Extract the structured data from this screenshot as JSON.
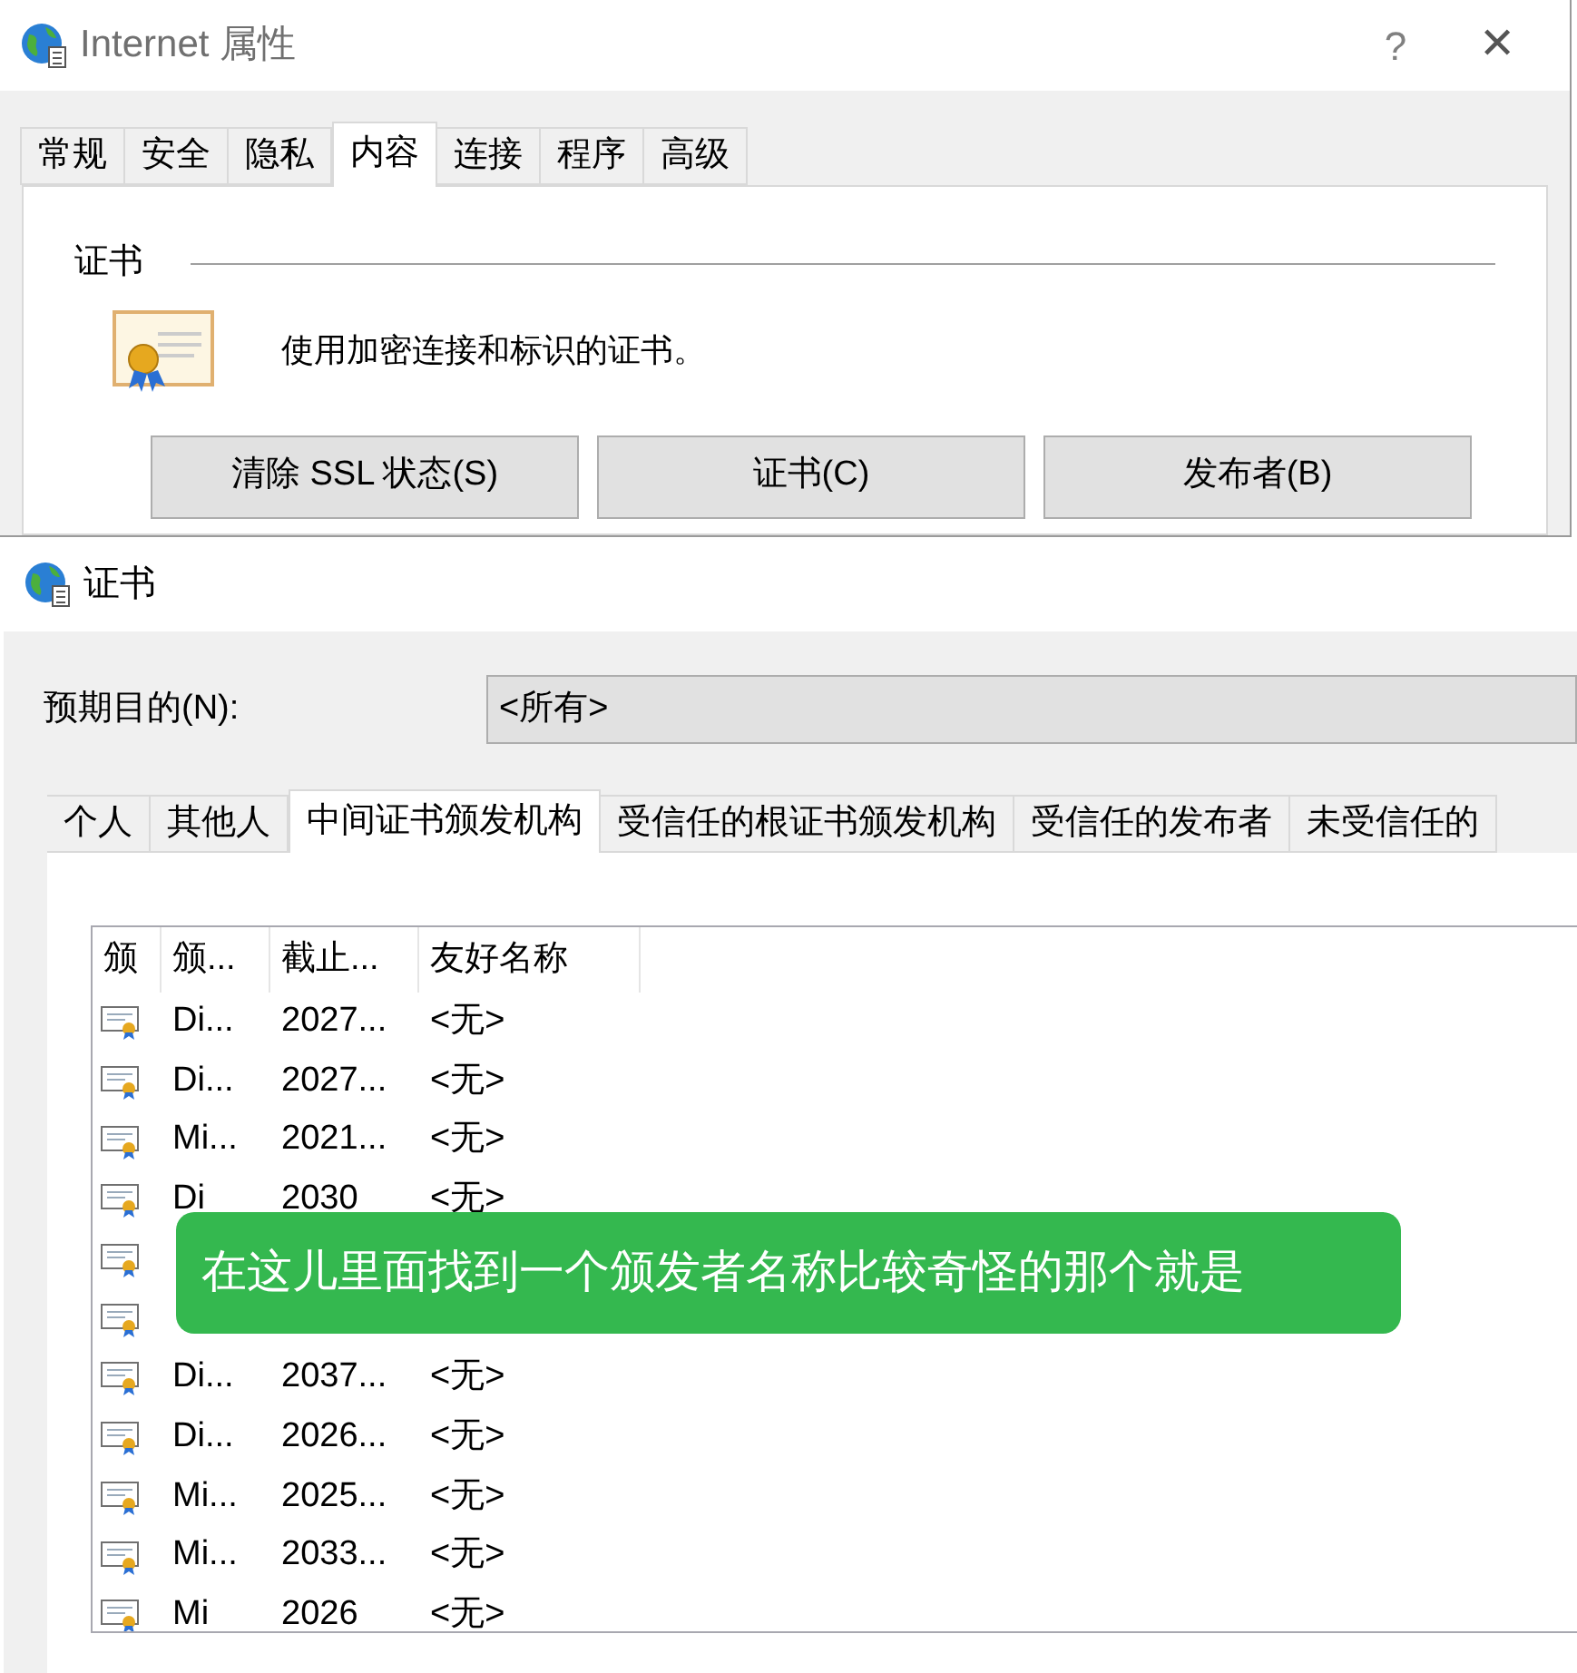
{
  "internet_options": {
    "title": "Internet 属性",
    "help": "?",
    "close": "✕",
    "tabs": [
      {
        "label": "常规",
        "selected": false
      },
      {
        "label": "安全",
        "selected": false
      },
      {
        "label": "隐私",
        "selected": false
      },
      {
        "label": "内容",
        "selected": true
      },
      {
        "label": "连接",
        "selected": false
      },
      {
        "label": "程序",
        "selected": false
      },
      {
        "label": "高级",
        "selected": false
      }
    ],
    "section": "证书",
    "description": "使用加密连接和标识的证书。",
    "buttons": [
      "清除 SSL 状态(S)",
      "证书(C)",
      "发布者(B)"
    ]
  },
  "certificates": {
    "title": "证书",
    "purpose_label": "预期目的(N):",
    "purpose_value": "<所有>",
    "tabs": [
      {
        "label": "个人",
        "selected": false
      },
      {
        "label": "其他人",
        "selected": false
      },
      {
        "label": "中间证书颁发机构",
        "selected": true
      },
      {
        "label": "受信任的根证书颁发机构",
        "selected": false
      },
      {
        "label": "受信任的发布者",
        "selected": false
      },
      {
        "label": "未受信任的",
        "selected": false
      }
    ],
    "columns": [
      "颁",
      "颁...",
      "截止...",
      "友好名称"
    ],
    "rows": [
      {
        "issued_by": "Di...",
        "expires": "2027...",
        "friendly_name": "<无>"
      },
      {
        "issued_by": "Di...",
        "expires": "2027...",
        "friendly_name": "<无>"
      },
      {
        "issued_by": "Mi...",
        "expires": "2021...",
        "friendly_name": "<无>"
      },
      {
        "issued_by": "Di",
        "expires": "2030",
        "friendly_name": "<无>"
      },
      {},
      {},
      {
        "issued_by": "Di...",
        "expires": "2037...",
        "friendly_name": "<无>"
      },
      {
        "issued_by": "Di...",
        "expires": "2026...",
        "friendly_name": "<无>"
      },
      {
        "issued_by": "Mi...",
        "expires": "2025...",
        "friendly_name": "<无>"
      },
      {
        "issued_by": "Mi...",
        "expires": "2033...",
        "friendly_name": "<无>"
      },
      {
        "issued_by": "Mi",
        "expires": "2026",
        "friendly_name": "<无>"
      }
    ]
  },
  "callout": "在这儿里面找到一个颁发者名称比较奇怪的那个就是"
}
